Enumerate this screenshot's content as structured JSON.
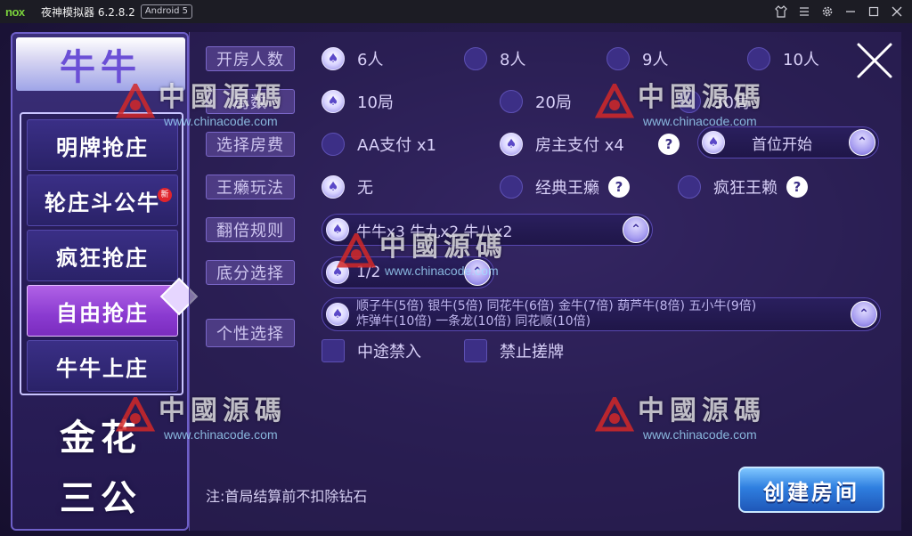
{
  "window": {
    "logo": "nox",
    "title": "夜神模拟器 6.2.8.2",
    "android_badge": "Android 5"
  },
  "nav": {
    "main_tabs": [
      "牛牛",
      "金花",
      "三公"
    ],
    "sub_items": [
      "明牌抢庄",
      "轮庄斗公牛",
      "疯狂抢庄",
      "自由抢庄",
      "牛牛上庄"
    ],
    "new_badge": "新"
  },
  "rows": {
    "players": {
      "label": "开房人数",
      "options": [
        "6人",
        "8人",
        "9人",
        "10人"
      ]
    },
    "rounds": {
      "label": "局数",
      "options": [
        "10局",
        "20局",
        "30局"
      ]
    },
    "fee": {
      "label": "选择房费",
      "options": [
        "AA支付 x1",
        "房主支付 x4"
      ]
    },
    "start": {
      "value": "首位开始"
    },
    "wild": {
      "label": "王癞玩法",
      "options": [
        "无",
        "经典王癞",
        "疯狂王赖"
      ]
    },
    "double": {
      "label": "翻倍规则",
      "value": "牛牛x3 牛九x2 牛八x2"
    },
    "base": {
      "label": "底分选择",
      "value": "1/2"
    },
    "personal": {
      "label": "个性选择",
      "line1": "顺子牛(5倍)  银牛(5倍)  同花牛(6倍)  金牛(7倍)  葫芦牛(8倍)  五小牛(9倍)",
      "line2": "炸弹牛(10倍)  一条龙(10倍)  同花顺(10倍)",
      "checks": [
        "中途禁入",
        "禁止搓牌"
      ]
    }
  },
  "help_mark": "?",
  "footnote": "注:首局结算前不扣除钻石",
  "create_button": "创建房间",
  "watermark": {
    "cn": "中國源碼",
    "url": "www.chinacode.com"
  },
  "colors": {
    "accent": "#6b4fd6",
    "active_sub": "#9a48d8",
    "create": "#2f7fe0"
  }
}
